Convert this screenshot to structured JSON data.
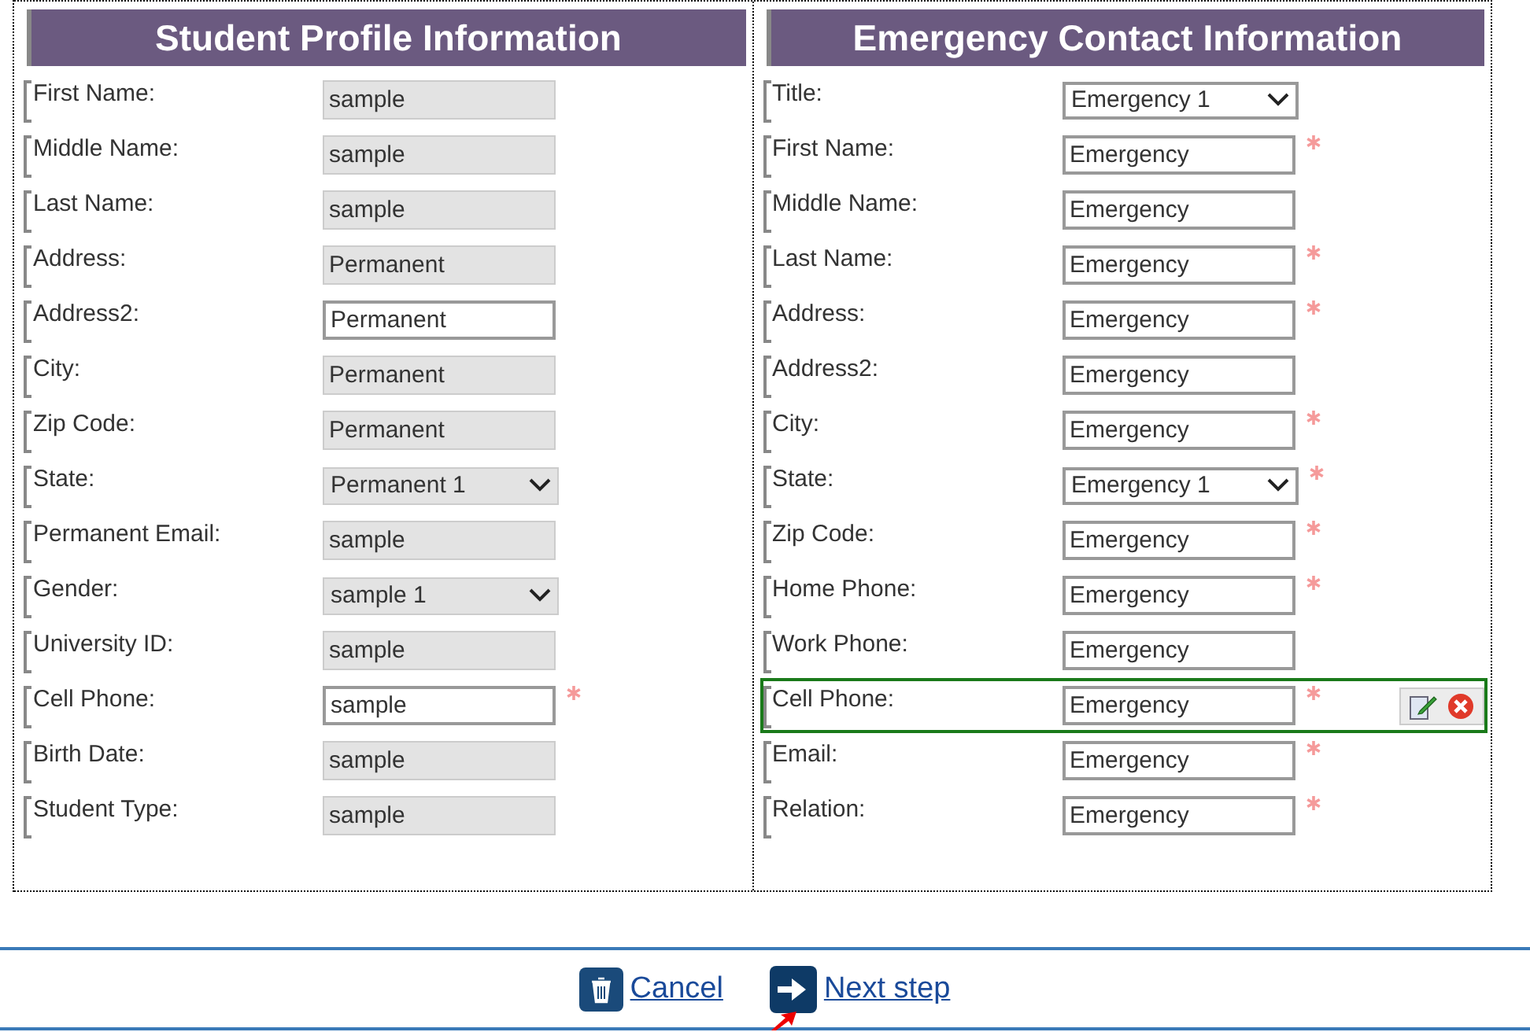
{
  "student_profile": {
    "title": "Student Profile Information",
    "fields": [
      {
        "label": "First Name:",
        "kind": "text",
        "value": "sample",
        "disabled": true,
        "required": false
      },
      {
        "label": "Middle Name:",
        "kind": "text",
        "value": "sample",
        "disabled": true,
        "required": false
      },
      {
        "label": "Last Name:",
        "kind": "text",
        "value": "sample",
        "disabled": true,
        "required": false
      },
      {
        "label": "Address:",
        "kind": "text",
        "value": "Permanent",
        "disabled": true,
        "required": false
      },
      {
        "label": "Address2:",
        "kind": "text",
        "value": "Permanent",
        "disabled": false,
        "required": false
      },
      {
        "label": "City:",
        "kind": "text",
        "value": "Permanent",
        "disabled": true,
        "required": false
      },
      {
        "label": "Zip Code:",
        "kind": "text",
        "value": "Permanent",
        "disabled": true,
        "required": false
      },
      {
        "label": "State:",
        "kind": "select",
        "value": "Permanent 1",
        "disabled": true,
        "required": false
      },
      {
        "label": "Permanent Email:",
        "kind": "text",
        "value": "sample",
        "disabled": true,
        "required": false
      },
      {
        "label": "Gender:",
        "kind": "select",
        "value": "sample 1",
        "disabled": true,
        "required": false
      },
      {
        "label": "University ID:",
        "kind": "text",
        "value": "sample",
        "disabled": true,
        "required": false
      },
      {
        "label": "Cell Phone:",
        "kind": "text",
        "value": "sample",
        "disabled": false,
        "required": true
      },
      {
        "label": "Birth Date:",
        "kind": "text",
        "value": "sample",
        "disabled": true,
        "required": false
      },
      {
        "label": "Student Type:",
        "kind": "text",
        "value": "sample",
        "disabled": true,
        "required": false
      }
    ]
  },
  "emergency_contact": {
    "title": "Emergency Contact Information",
    "fields": [
      {
        "label": "Title:",
        "kind": "select",
        "value": "Emergency 1",
        "disabled": false,
        "required": false,
        "highlighted": false
      },
      {
        "label": "First Name:",
        "kind": "text",
        "value": "Emergency",
        "disabled": false,
        "required": true,
        "highlighted": false
      },
      {
        "label": "Middle Name:",
        "kind": "text",
        "value": "Emergency",
        "disabled": false,
        "required": false,
        "highlighted": false
      },
      {
        "label": "Last Name:",
        "kind": "text",
        "value": "Emergency",
        "disabled": false,
        "required": true,
        "highlighted": false
      },
      {
        "label": "Address:",
        "kind": "text",
        "value": "Emergency",
        "disabled": false,
        "required": true,
        "highlighted": false
      },
      {
        "label": "Address2:",
        "kind": "text",
        "value": "Emergency",
        "disabled": false,
        "required": false,
        "highlighted": false
      },
      {
        "label": "City:",
        "kind": "text",
        "value": "Emergency",
        "disabled": false,
        "required": true,
        "highlighted": false
      },
      {
        "label": "State:",
        "kind": "select",
        "value": "Emergency 1",
        "disabled": false,
        "required": true,
        "highlighted": false
      },
      {
        "label": "Zip Code:",
        "kind": "text",
        "value": "Emergency",
        "disabled": false,
        "required": true,
        "highlighted": false
      },
      {
        "label": "Home Phone:",
        "kind": "text",
        "value": "Emergency",
        "disabled": false,
        "required": true,
        "highlighted": false
      },
      {
        "label": "Work Phone:",
        "kind": "text",
        "value": "Emergency",
        "disabled": false,
        "required": false,
        "highlighted": false
      },
      {
        "label": "Cell Phone:",
        "kind": "text",
        "value": "Emergency",
        "disabled": false,
        "required": true,
        "highlighted": true
      },
      {
        "label": "Email:",
        "kind": "text",
        "value": "Emergency",
        "disabled": false,
        "required": true,
        "highlighted": false
      },
      {
        "label": "Relation:",
        "kind": "text",
        "value": "Emergency",
        "disabled": false,
        "required": true,
        "highlighted": false
      }
    ]
  },
  "actions": [
    {
      "kind": "cancel",
      "label": "Cancel"
    },
    {
      "kind": "next",
      "label": "Next step"
    }
  ]
}
